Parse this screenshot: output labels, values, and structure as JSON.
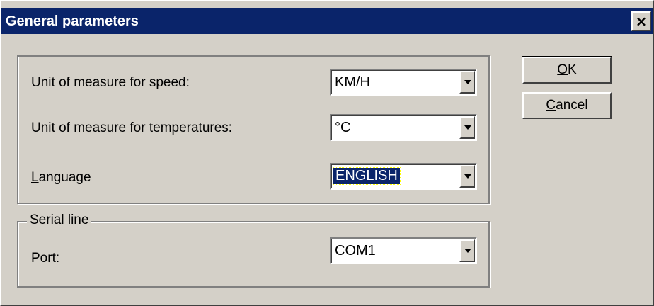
{
  "window": {
    "title": "General parameters",
    "close_label": "×"
  },
  "general_group": {
    "speed_label": "Unit of measure for speed:",
    "speed_value": "KM/H",
    "temperature_label": "Unit of measure for temperatures:",
    "temperature_value": "°C",
    "language_mnemonic": "L",
    "language_rest": "anguage",
    "language_value": "ENGLISH"
  },
  "serial_group": {
    "legend": "Serial line",
    "port_label": "Port:",
    "port_value": "COM1"
  },
  "buttons": {
    "ok_mnemonic": "O",
    "ok_rest": "K",
    "cancel_mnemonic": "C",
    "cancel_rest": "ancel"
  }
}
